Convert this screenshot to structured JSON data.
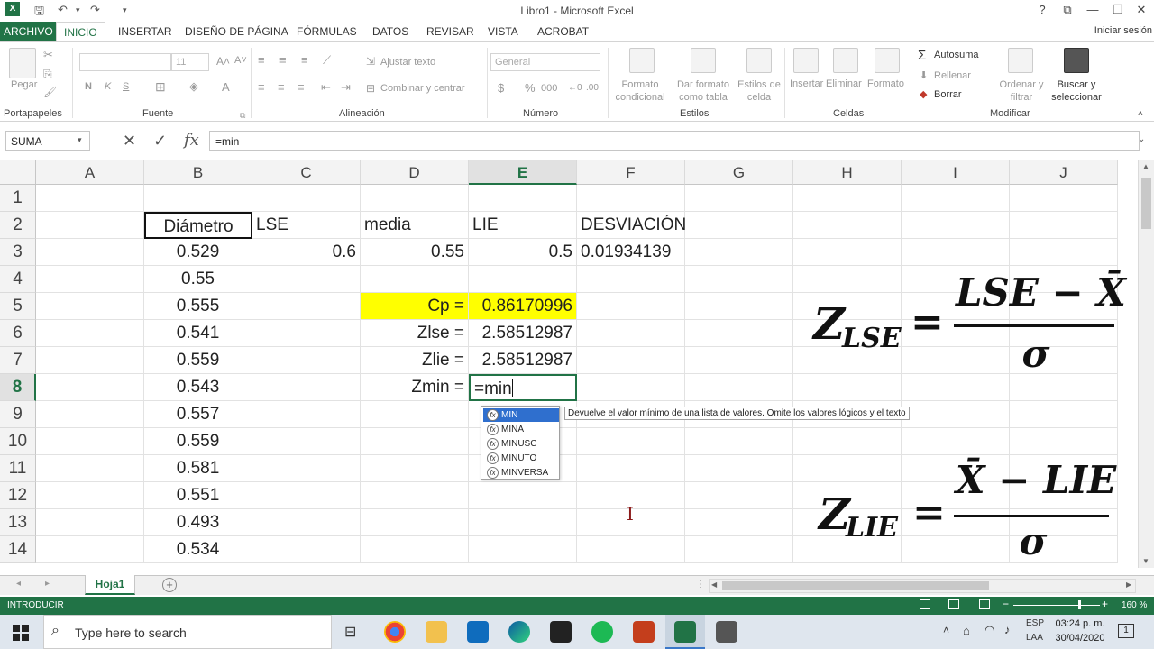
{
  "window": {
    "title": "Libro1 - Microsoft Excel"
  },
  "ribbon": {
    "tabs": [
      "ARCHIVO",
      "INICIO",
      "INSERTAR",
      "DISEÑO DE PÁGINA",
      "FÓRMULAS",
      "DATOS",
      "REVISAR",
      "VISTA",
      "ACROBAT"
    ],
    "active_tab": "INICIO",
    "signin": "Iniciar sesión",
    "groups": [
      "Portapapeles",
      "Fuente",
      "Alineación",
      "Número",
      "Estilos",
      "Celdas",
      "Modificar"
    ],
    "paste": "Pegar",
    "font_size": "11",
    "bold": "N",
    "italic": "K",
    "underline": "S",
    "wrap_text": "Ajustar texto",
    "merge_center": "Combinar y centrar",
    "number_format": "General",
    "currency": "$",
    "percent": "%",
    "thousands": "000",
    "cond_format": "Formato condicional",
    "table_format": "Dar formato como tabla",
    "cell_styles": "Estilos de celda",
    "insert": "Insertar",
    "delete": "Eliminar",
    "format": "Formato",
    "autosum": "Autosuma",
    "fill": "Rellenar",
    "clear": "Borrar",
    "sort": "Ordenar y filtrar",
    "find": "Buscar y seleccionar"
  },
  "formula_bar": {
    "name_box": "SUMA",
    "fx": "fx",
    "content": "=min"
  },
  "columns": [
    "A",
    "B",
    "C",
    "D",
    "E",
    "F",
    "G",
    "H",
    "I",
    "J"
  ],
  "selected_column": "E",
  "rows": [
    "1",
    "2",
    "3",
    "4",
    "5",
    "6",
    "7",
    "8",
    "9",
    "10",
    "11",
    "12",
    "13",
    "14"
  ],
  "selected_row": "8",
  "cells": {
    "B2": "Diámetro",
    "C2": "LSE",
    "D2": "media",
    "E2": "LIE",
    "F2": "DESVIACIÓN",
    "B3": "0.529",
    "C3": "0.6",
    "D3": "0.55",
    "E3": "0.5",
    "F3": "0.01934139",
    "B4": "0.55",
    "B5": "0.555",
    "B6": "0.541",
    "B7": "0.559",
    "B8": "0.543",
    "B9": "0.557",
    "B10": "0.559",
    "B11": "0.581",
    "B12": "0.551",
    "B13": "0.493",
    "B14": "0.534",
    "D5": "Cp =",
    "E5": "0.86170996",
    "D6": "Zlse =",
    "E6": "2.58512987",
    "D7": "Zlie =",
    "E7": "2.58512987",
    "D8": "Zmin =",
    "E8": "=min"
  },
  "autocomplete": {
    "items": [
      "MIN",
      "MINA",
      "MINUSC",
      "MINUTO",
      "MINVERSA"
    ],
    "tooltip": "Devuelve el valor mínimo de una lista de valores. Omite los valores lógicos y el texto"
  },
  "equations": {
    "z1_base": "Z",
    "z1_sub": "LSE",
    "z1_num": "LSE − X̄",
    "z1_den": "σ",
    "z2_base": "Z",
    "z2_sub": "LIE",
    "z2_num": "X̄ − LIE",
    "z2_den": "σ",
    "equals": "="
  },
  "sheet_tabs": [
    "Hoja1"
  ],
  "status": {
    "mode": "INTRODUCIR",
    "zoom": "160 %"
  },
  "taskbar": {
    "search_placeholder": "Type here to search",
    "lang1": "ESP",
    "lang2": "LAA",
    "time": "03:24 p. m.",
    "date": "30/04/2020",
    "notifications": "1"
  },
  "colors": {
    "excel_green": "#217346",
    "highlight_yellow": "#ffff00",
    "ac_select": "#2f6fce"
  }
}
